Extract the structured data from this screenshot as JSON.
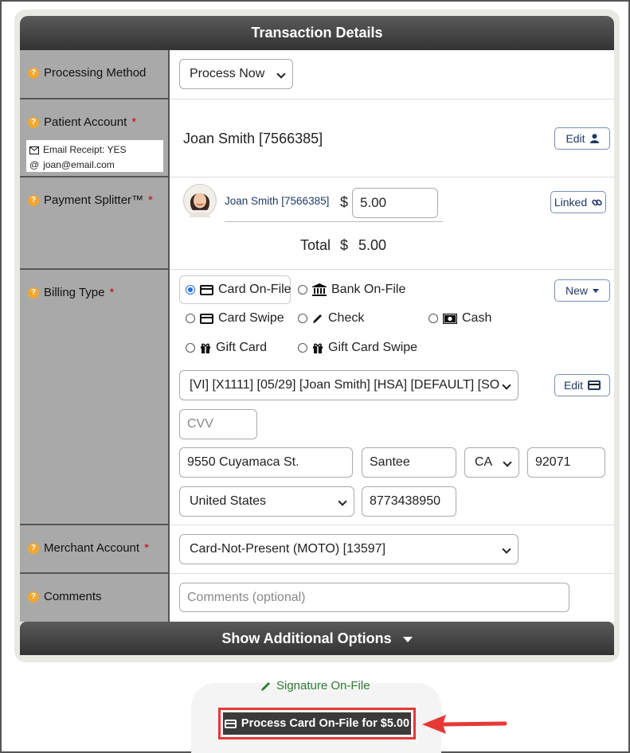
{
  "header": {
    "title": "Transaction Details"
  },
  "rows": {
    "processing_method": {
      "label": "Processing Method",
      "value": "Process Now"
    },
    "patient_account": {
      "label": "Patient Account",
      "email_receipt": "Email Receipt: YES",
      "email": "joan@email.com",
      "patient_name": "Joan Smith [7566385]",
      "edit_label": "Edit"
    },
    "payment_splitter": {
      "label": "Payment Splitter™",
      "patient_link": "Joan Smith [7566385]",
      "currency": "$",
      "amount": "5.00",
      "linked_label": "Linked",
      "total_label": "Total",
      "total_currency": "$",
      "total_amount": "5.00"
    },
    "billing_type": {
      "label": "Billing Type",
      "new_label": "New",
      "options": {
        "card_on_file": "Card On-File",
        "bank_on_file": "Bank On-File",
        "card_swipe": "Card Swipe",
        "check": "Check",
        "cash": "Cash",
        "gift_card": "Gift Card",
        "gift_card_swipe": "Gift Card Swipe"
      },
      "selected": "card_on_file",
      "card_select": "[VI] [X1111] [05/29] [Joan Smith] [HSA] [DEFAULT] [SO",
      "card_edit_label": "Edit",
      "cvv_placeholder": "CVV",
      "address": "9550 Cuyamaca St.",
      "city": "Santee",
      "state": "CA",
      "zip": "92071",
      "country": "United States",
      "phone": "8773438950"
    },
    "merchant_account": {
      "label": "Merchant Account",
      "value": "Card-Not-Present (MOTO) [13597]"
    },
    "comments": {
      "label": "Comments",
      "placeholder": "Comments (optional)"
    }
  },
  "additional_options": {
    "label": "Show Additional Options"
  },
  "footer": {
    "signature_label": "Signature On-File",
    "process_button": "Process Card On-File for $5.00"
  },
  "colors": {
    "accent_red": "#e53935",
    "help_orange": "#f0a830",
    "signature_green": "#2e7d32"
  }
}
